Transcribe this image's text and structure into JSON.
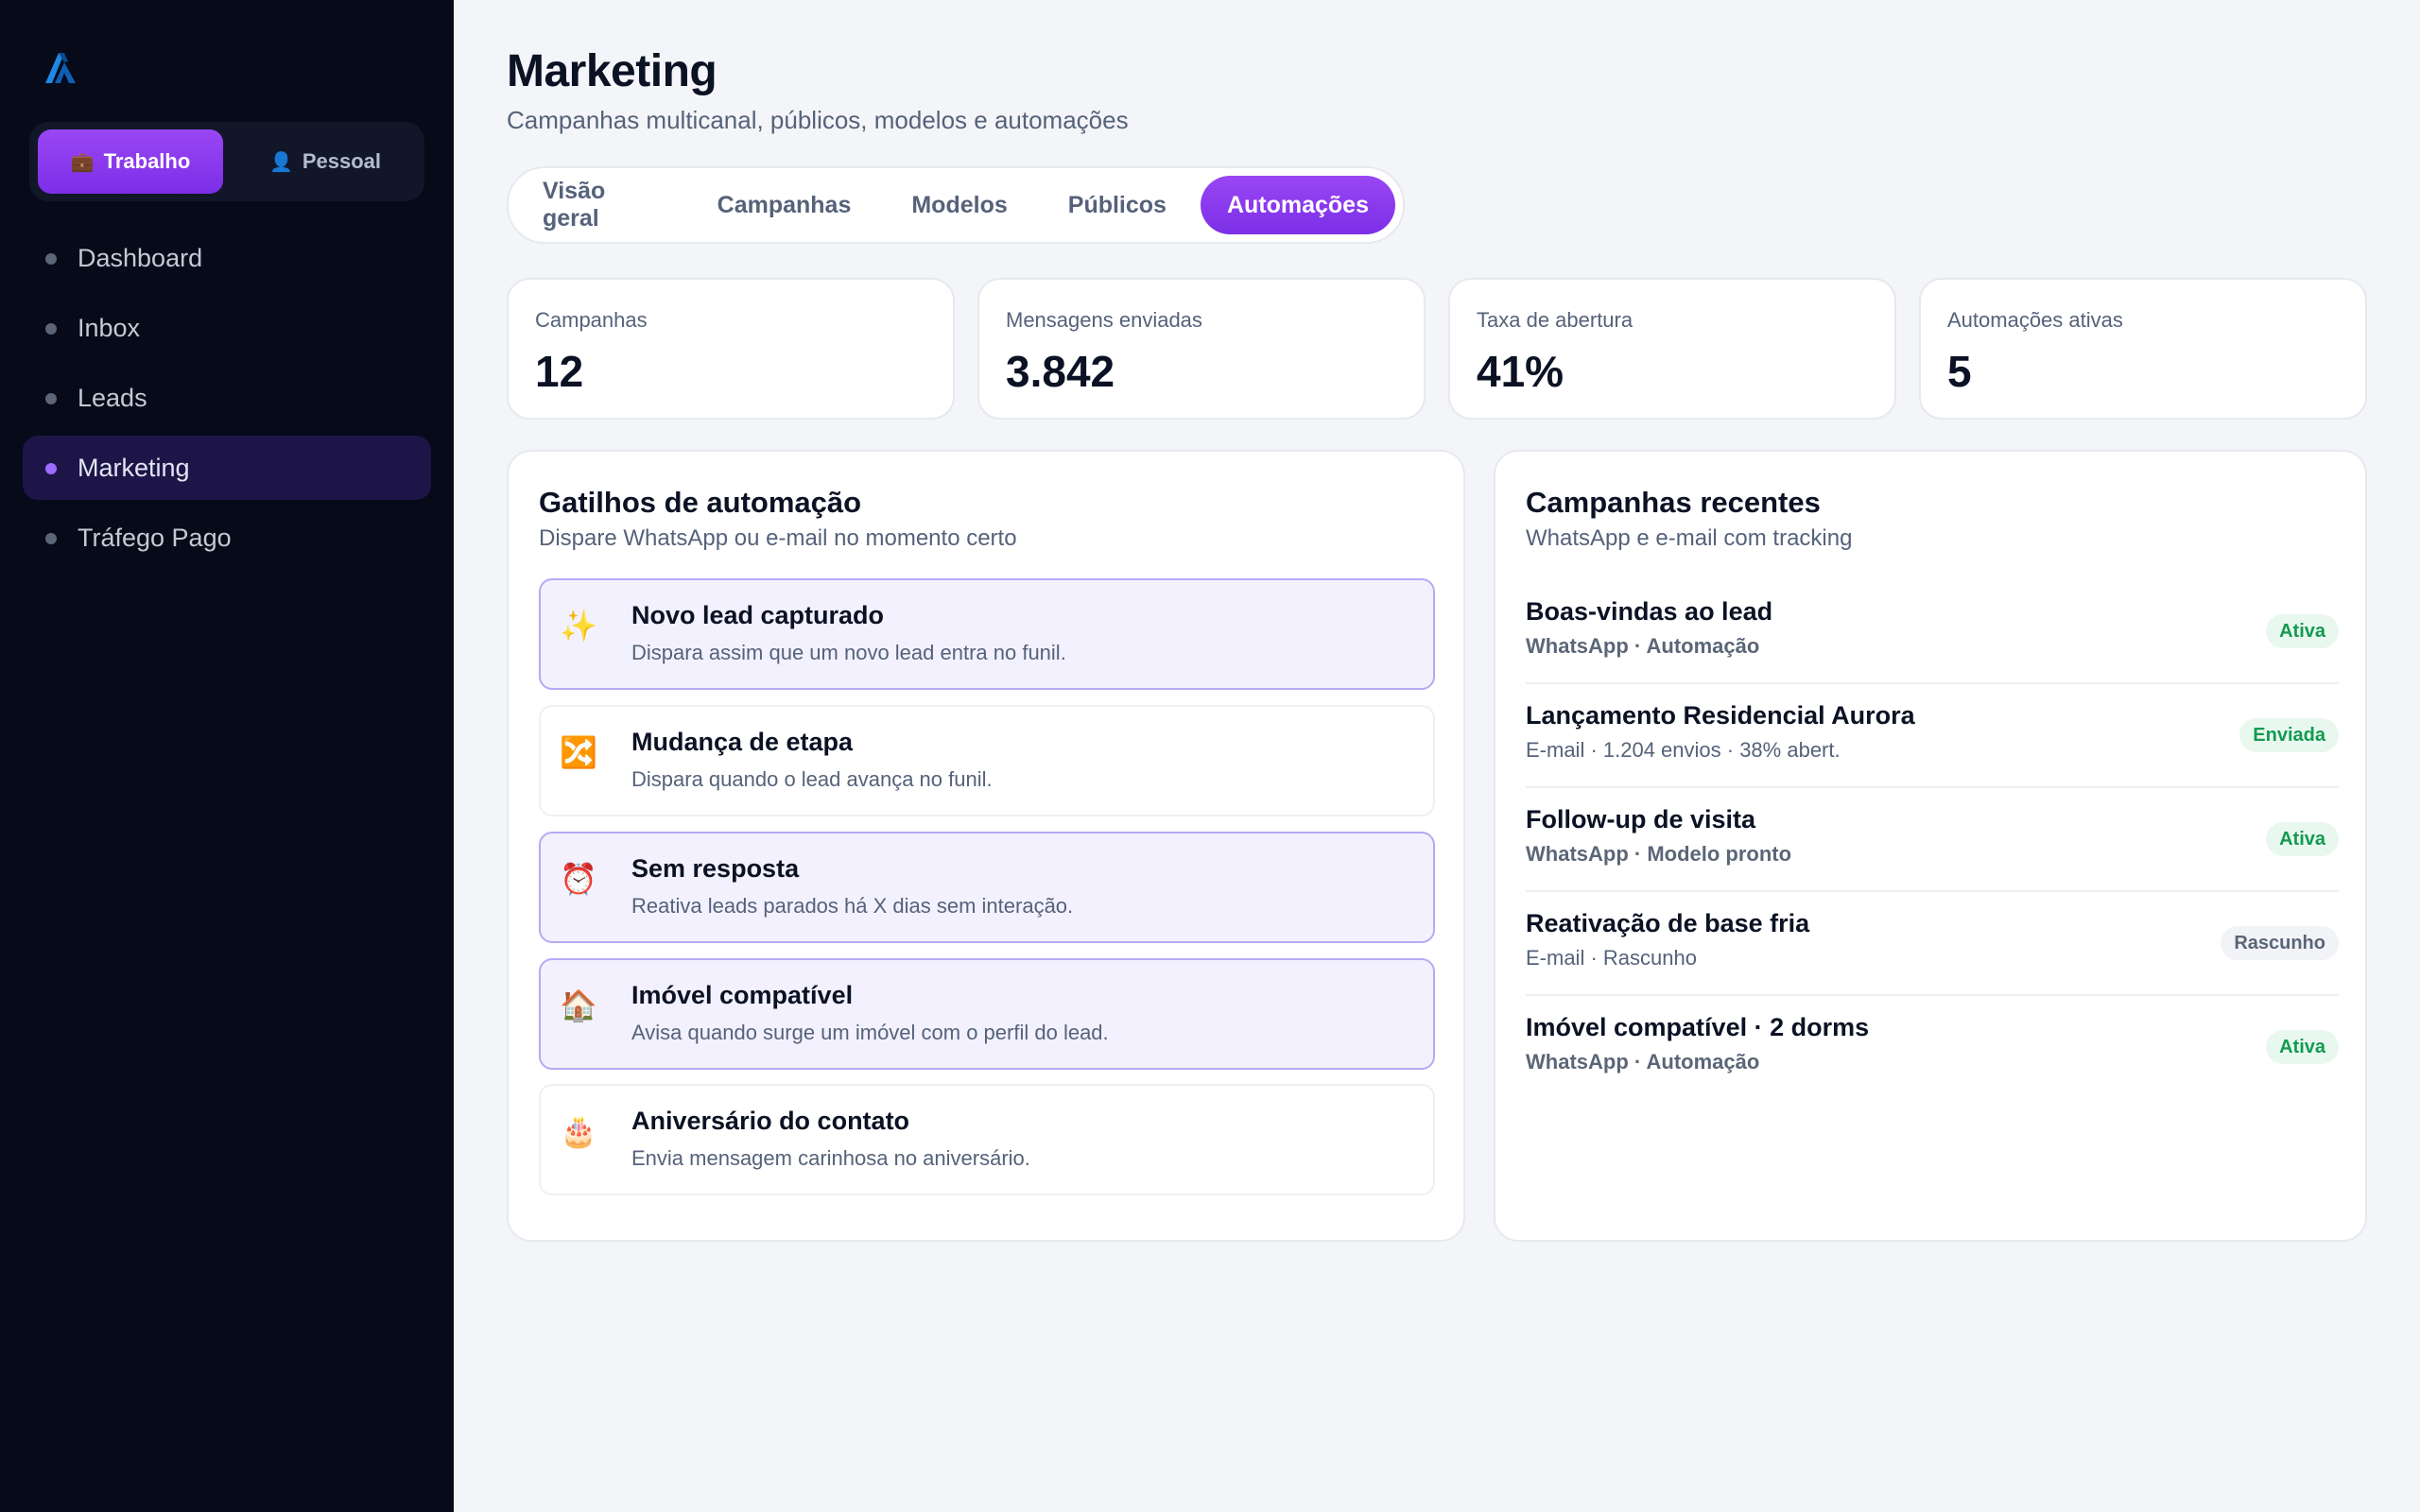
{
  "colors": {
    "sidebar_bg": "#060a19",
    "accent": "#8b3cf0",
    "active_nav_bg": "#1d1548",
    "page_bg": "#f4f5f8",
    "success": "#139a52"
  },
  "sidebar": {
    "logo_icon": "logo-mark-icon",
    "modes": [
      {
        "label": "Trabalho",
        "icon": "briefcase-icon",
        "glyph": "💼",
        "active": true
      },
      {
        "label": "Pessoal",
        "icon": "person-icon",
        "glyph": "👤",
        "active": false
      }
    ],
    "nav": [
      {
        "label": "Dashboard",
        "active": false
      },
      {
        "label": "Inbox",
        "active": false
      },
      {
        "label": "Leads",
        "active": false
      },
      {
        "label": "Marketing",
        "active": true
      },
      {
        "label": "Tráfego Pago",
        "active": false
      }
    ]
  },
  "header": {
    "title": "Marketing",
    "subtitle": "Campanhas multicanal, públicos, modelos e automações"
  },
  "tabs": [
    {
      "label": "Visão geral",
      "active": false
    },
    {
      "label": "Campanhas",
      "active": false
    },
    {
      "label": "Modelos",
      "active": false
    },
    {
      "label": "Públicos",
      "active": false
    },
    {
      "label": "Automações",
      "active": true
    }
  ],
  "stats": [
    {
      "label": "Campanhas",
      "value": "12"
    },
    {
      "label": "Mensagens enviadas",
      "value": "3.842"
    },
    {
      "label": "Taxa de abertura",
      "value": "41%"
    },
    {
      "label": "Automações ativas",
      "value": "5"
    }
  ],
  "triggers_panel": {
    "title": "Gatilhos de automação",
    "subtitle": "Dispare WhatsApp ou e-mail no momento certo",
    "items": [
      {
        "title": "Novo lead capturado",
        "description": "Dispara assim que um novo lead entra no funil.",
        "icon": "sparkles-icon",
        "glyph": "✨",
        "enabled": true
      },
      {
        "title": "Mudança de etapa",
        "description": "Dispara quando o lead avança no funil.",
        "icon": "shuffle-icon",
        "glyph": "🔀",
        "enabled": false
      },
      {
        "title": "Sem resposta",
        "description": "Reativa leads parados há X dias sem interação.",
        "icon": "alarm-clock-icon",
        "glyph": "⏰",
        "enabled": true
      },
      {
        "title": "Imóvel compatível",
        "description": "Avisa quando surge um imóvel com o perfil do lead.",
        "icon": "house-icon",
        "glyph": "🏠",
        "enabled": true
      },
      {
        "title": "Aniversário do contato",
        "description": "Envia mensagem carinhosa no aniversário.",
        "icon": "birthday-cake-icon",
        "glyph": "🎂",
        "enabled": false
      }
    ]
  },
  "campaigns_panel": {
    "title": "Campanhas recentes",
    "subtitle": "WhatsApp e e-mail com tracking",
    "items": [
      {
        "title": "Boas-vindas ao lead",
        "meta": "WhatsApp · Automação",
        "status": "Ativa",
        "status_kind": "active"
      },
      {
        "title": "Lançamento Residencial Aurora",
        "meta": "E-mail · 1.204 envios · 38% abert.",
        "status": "Enviada",
        "status_kind": "sent"
      },
      {
        "title": "Follow-up de visita",
        "meta": "WhatsApp · Modelo pronto",
        "status": "Ativa",
        "status_kind": "active"
      },
      {
        "title": "Reativação de base fria",
        "meta": "E-mail · Rascunho",
        "status": "Rascunho",
        "status_kind": "draft"
      },
      {
        "title": "Imóvel compatível · 2 dorms",
        "meta": "WhatsApp · Automação",
        "status": "Ativa",
        "status_kind": "active"
      }
    ]
  }
}
